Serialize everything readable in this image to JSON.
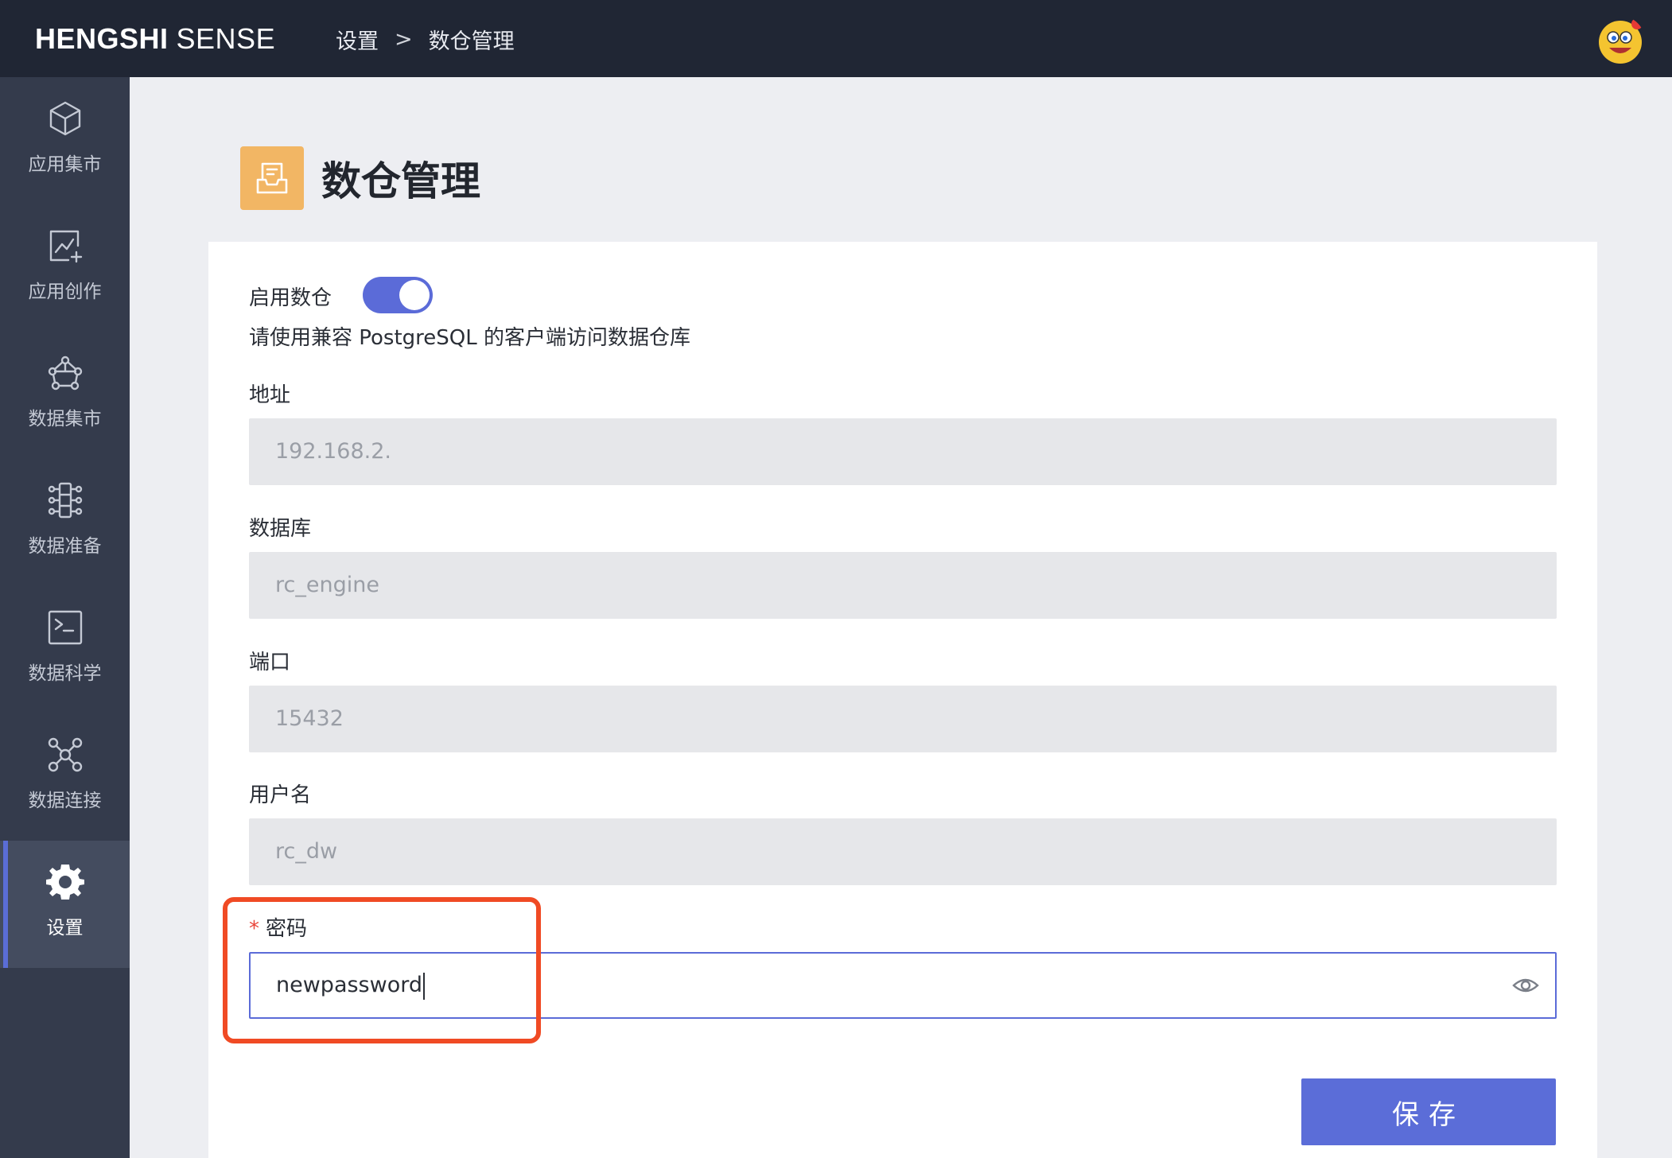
{
  "app": {
    "brand_bold": "HENGSHI",
    "brand_light": "SENSE",
    "breadcrumb": [
      "设置",
      ">",
      "数仓管理"
    ]
  },
  "sidebar": {
    "items": [
      {
        "label": "应用集市",
        "icon": "cube-icon"
      },
      {
        "label": "应用创作",
        "icon": "chart-edit-icon"
      },
      {
        "label": "数据集市",
        "icon": "network-hex-icon"
      },
      {
        "label": "数据准备",
        "icon": "pipeline-icon"
      },
      {
        "label": "数据科学",
        "icon": "terminal-icon"
      },
      {
        "label": "数据连接",
        "icon": "connection-icon"
      },
      {
        "label": "设置",
        "icon": "gear-icon",
        "active": true
      }
    ]
  },
  "page": {
    "title": "数仓管理",
    "title_icon": "inbox-icon",
    "title_icon_color": "#f2b664"
  },
  "form": {
    "enable_label": "启用数仓",
    "enable_state": true,
    "description": "请使用兼容 PostgreSQL 的客户端访问数据仓库",
    "address_label": "地址",
    "address_value": "192.168.2.",
    "database_label": "数据库",
    "database_value": "rc_engine",
    "port_label": "端口",
    "port_value": "15432",
    "username_label": "用户名",
    "username_value": "rc_dw",
    "password_required": "*",
    "password_label": "密码",
    "password_value": "newpassword",
    "save_label": "保存"
  },
  "colors": {
    "accent": "#5b6bd8",
    "topbar": "#202634",
    "sidebar": "#343b4c",
    "highlight": "#f04a24"
  }
}
